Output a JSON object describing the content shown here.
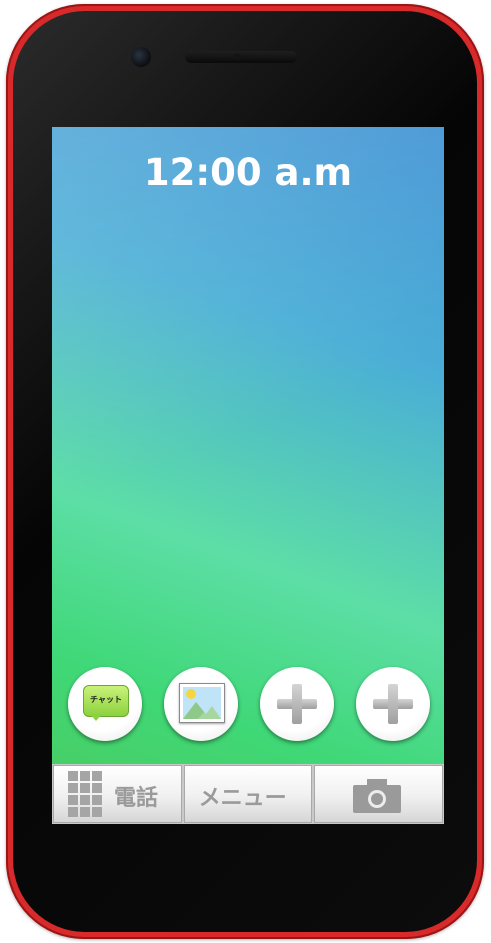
{
  "status": {
    "time": "12:00 a.m"
  },
  "apps": [
    {
      "name": "chat",
      "label": "チャット"
    },
    {
      "name": "photos"
    },
    {
      "name": "add"
    },
    {
      "name": "add"
    }
  ],
  "bottom_bar": {
    "phone_label": "電話",
    "menu_label": "メニュー"
  },
  "colors": {
    "phone_body": "#d82a2a",
    "wallpaper_top": "#3a8fd3",
    "wallpaper_bottom": "#4cca5e",
    "chat_bubble": "#8dd13e"
  }
}
